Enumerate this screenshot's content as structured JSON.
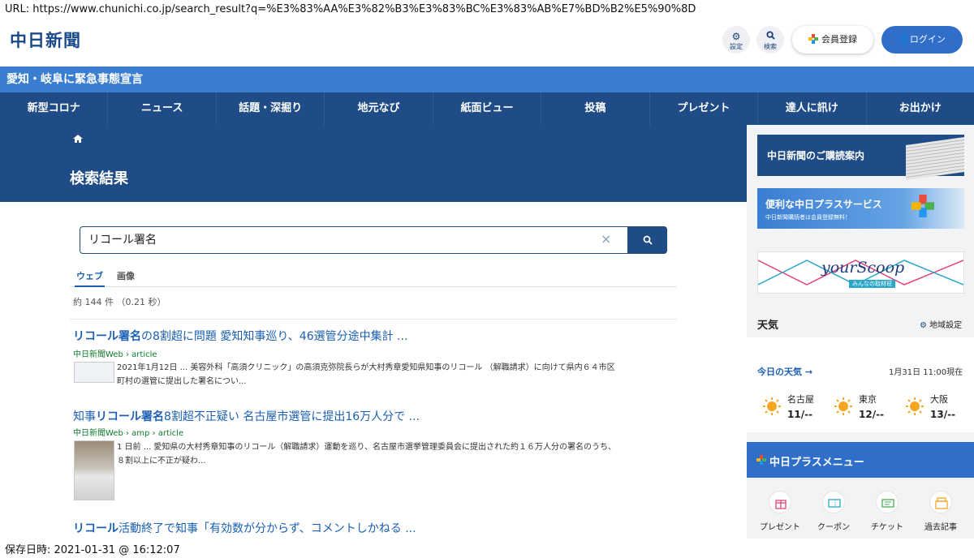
{
  "url_bar": "URL:  https://www.chunichi.co.jp/search_result?q=%E3%83%AA%E3%82%B3%E3%83%BC%E3%83%AB%E7%BD%B2%E5%90%8D",
  "header": {
    "logo": "中日新聞",
    "settings_label": "設定",
    "search_label": "検索",
    "member_label": "会員登録",
    "login_label": "ログイン"
  },
  "alert": "愛知・岐阜に緊急事態宣言",
  "nav": [
    "新型コロナ",
    "ニュース",
    "話題・深掘り",
    "地元なび",
    "紙面ビュー",
    "投稿",
    "プレゼント",
    "達人に訊け",
    "お出かけ"
  ],
  "hero": {
    "title": "検索結果"
  },
  "search": {
    "value": "リコール署名",
    "clear": "×"
  },
  "tabs": {
    "web": "ウェブ",
    "images": "画像"
  },
  "result_count": "約 144 件 （0.21 秒）",
  "results": [
    {
      "title_hl": "リコール署名",
      "title_rest": "の8割超に問題 愛知知事巡り、46選管分途中集計 ...",
      "url": "中日新聞Web › article",
      "snippet_line1": "2021年1月12日 ... 美容外科「高須クリニック」の高須克弥院長らが大村秀章愛知県知事のリコール （解職請求）に向けて県内６４市区",
      "snippet_line2": "町村の選管に提出した署名につい..."
    },
    {
      "title_pre": "知事",
      "title_hl": "リコール署名",
      "title_rest": "8割超不正疑い 名古屋市選管に提出16万人分で ...",
      "url": "中日新聞Web › amp › article",
      "snippet_line1": "1 日前 ... 愛知県の大村秀章知事のリコール（解職請求）運動を巡り、名古屋市選挙管理委員会に提出された約１６万人分の署名のうち、",
      "snippet_line2": "８割以上に不正が疑わ..."
    },
    {
      "title_hl": "リコール",
      "title_rest": "活動終了で知事「有効数が分からず、コメントしかねる ..."
    }
  ],
  "footer_saved": "保存日時:  2021-01-31 @ 16:12:07",
  "sidebar": {
    "banner1": "中日新聞のご購読案内",
    "banner2_title": "便利な中日プラスサービス",
    "banner2_sub": "中日新聞購読者は会員登録無料！",
    "banner3_text": "yourScoop",
    "banner3_sub": "みんなの取材班",
    "weather": {
      "title": "天気",
      "settings": "地域設定",
      "today": "今日の天気 →",
      "time": "1月31日 11:00現在",
      "cities": [
        {
          "name": "名古屋",
          "temp": "11/--"
        },
        {
          "name": "東京",
          "temp": "12/--"
        },
        {
          "name": "大阪",
          "temp": "13/--"
        }
      ]
    },
    "menu": {
      "title": "中日プラスメニュー",
      "items": [
        "プレゼント",
        "クーポン",
        "チケット",
        "過去記事"
      ]
    }
  }
}
